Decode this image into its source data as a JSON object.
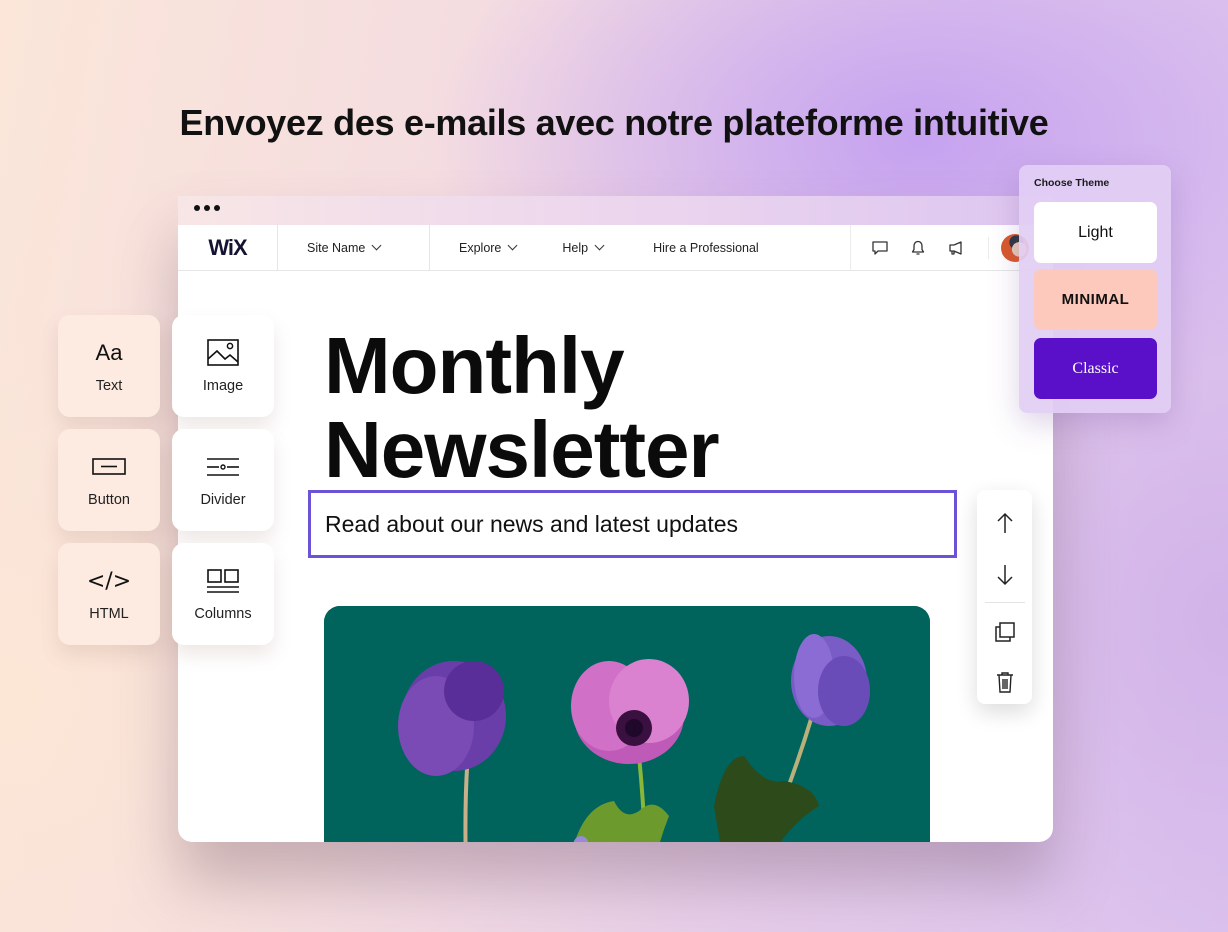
{
  "headline": "Envoyez des e-mails avec notre plateforme intuitive",
  "editor": {
    "logo": "WiX",
    "site_name": "Site Name",
    "nav": {
      "explore": "Explore",
      "help": "Help",
      "hire": "Hire a Professional"
    },
    "icons": [
      "chat-icon",
      "bell-icon",
      "megaphone-icon",
      "avatar"
    ],
    "newsletter_title_line1": "Monthly",
    "newsletter_title_line2": "Newsletter",
    "subtitle": "Read about our news and latest updates",
    "selection_color": "#6b52d6"
  },
  "elements_panel": {
    "items": [
      {
        "label": "Text",
        "icon": "text-icon"
      },
      {
        "label": "Image",
        "icon": "image-icon"
      },
      {
        "label": "Button",
        "icon": "button-icon"
      },
      {
        "label": "Divider",
        "icon": "divider-icon"
      },
      {
        "label": "HTML",
        "icon": "code-icon"
      },
      {
        "label": "Columns",
        "icon": "columns-icon"
      }
    ]
  },
  "toolstrip": [
    "move-up-icon",
    "move-down-icon",
    "duplicate-icon",
    "delete-icon"
  ],
  "theme_panel": {
    "title": "Choose Theme",
    "options": [
      {
        "label": "Light",
        "color": "#ffffff"
      },
      {
        "label": "MINIMAL",
        "color": "#fdc9bc"
      },
      {
        "label": "Classic",
        "color": "#5a0fc8"
      }
    ]
  }
}
